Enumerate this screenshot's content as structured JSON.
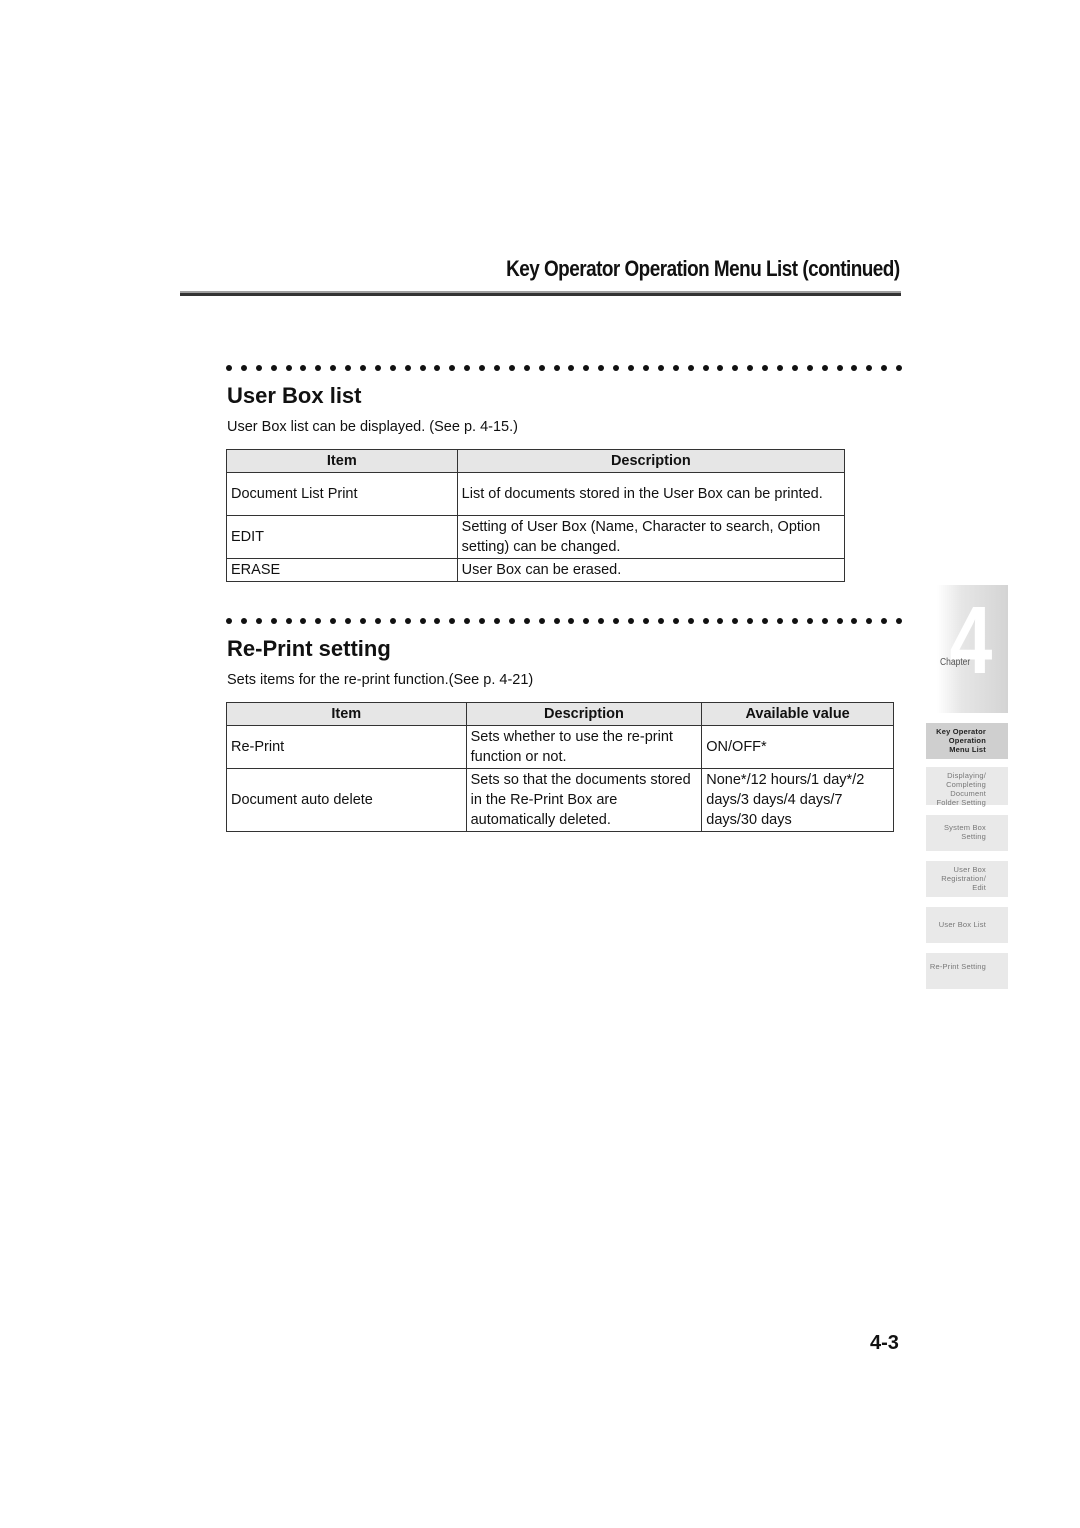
{
  "running_header": "Key Operator Operation Menu List (continued)",
  "sections": [
    {
      "title": "User Box list",
      "intro": "User Box list can be displayed. (See p. 4-15.)",
      "table": {
        "headers": [
          "Item",
          "Description"
        ],
        "rows": [
          [
            "Document List Print",
            "List of documents stored in the User Box can be printed."
          ],
          [
            "EDIT",
            "Setting of User Box (Name, Character to search, Option setting) can be changed."
          ],
          [
            "ERASE",
            "User Box can be erased."
          ]
        ]
      }
    },
    {
      "title": "Re-Print setting",
      "intro": "Sets items for the re-print function.(See p. 4-21)",
      "table": {
        "headers": [
          "Item",
          "Description",
          "Available value"
        ],
        "rows": [
          [
            "Re-Print",
            "Sets whether to use the re-print function or not.",
            "ON/OFF*"
          ],
          [
            "Document auto delete",
            "Sets so that the documents stored in the Re-Print Box are automatically deleted.",
            "None*/12 hours/1 day*/2 days/3 days/4 days/7 days/30 days"
          ]
        ]
      }
    }
  ],
  "sidebar": {
    "chapter_label": "Chapter",
    "chapter_number": "4",
    "tabs": [
      {
        "label": "Key Operator Operation Menu List",
        "active": true
      },
      {
        "label": "Displaying/ Completing Document Folder Setting",
        "active": false
      },
      {
        "label": "System Box Setting",
        "active": false
      },
      {
        "label": "User Box Registration/ Edit",
        "active": false
      },
      {
        "label": "User Box List",
        "active": false
      },
      {
        "label": "Re-Print Setting",
        "active": false
      }
    ]
  },
  "page_number": "4-3"
}
